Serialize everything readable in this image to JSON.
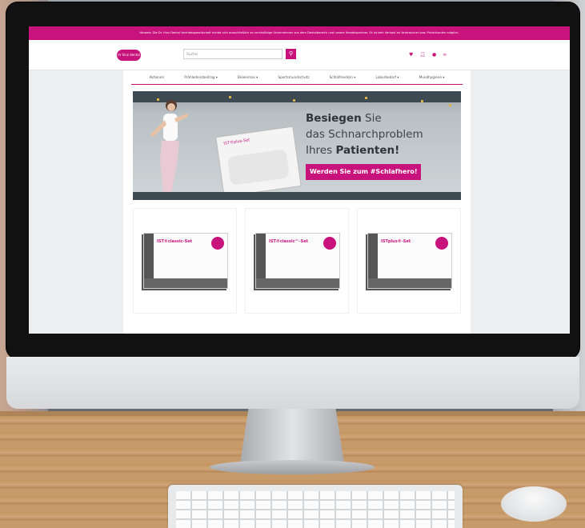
{
  "notice": {
    "text": "Hinweis: Die Dr. Hinz Dental Vertriebsgesellschaft richtet sich ausschließlich an rechtsfähige Unternehmen aus dem Dentalbereich und unsere Handelspartner. Es ist kein Verkauf an Verbraucher bzw. Privatkunden möglich."
  },
  "header": {
    "logo_text": "dr hinz dental",
    "search_placeholder": "Suche",
    "search_icon": "search-icon",
    "icons": [
      "heart-icon",
      "user-icon",
      "cart-icon",
      "glasses-icon"
    ]
  },
  "nav": {
    "items": [
      "Aktionen",
      "Prähledenzbeitrag ▾",
      "Bioeiemas ▾",
      "Sportsmundschutz",
      "Schlafmedizin ▾",
      "Laborbedarf ▾",
      "Mundhygiene ▾"
    ]
  },
  "banner": {
    "headline_bold": "Besiegen",
    "headline_rest": "Sie",
    "line2": "das Schnarchproblem",
    "line3_prefix": "Ihres",
    "line3_bold": "Patienten!",
    "cta": "Werden Sie zum #Schlafhero!",
    "kit_label": "IST®plus-Set"
  },
  "products": [
    {
      "name": "IST®classic-Set"
    },
    {
      "name": "IST®classic™-Set"
    },
    {
      "name": "ISTplus®-Set"
    }
  ],
  "colors": {
    "accent": "#c8137c",
    "banner_bg": "#cfd4d7",
    "banner_bar": "#3d4a52"
  }
}
